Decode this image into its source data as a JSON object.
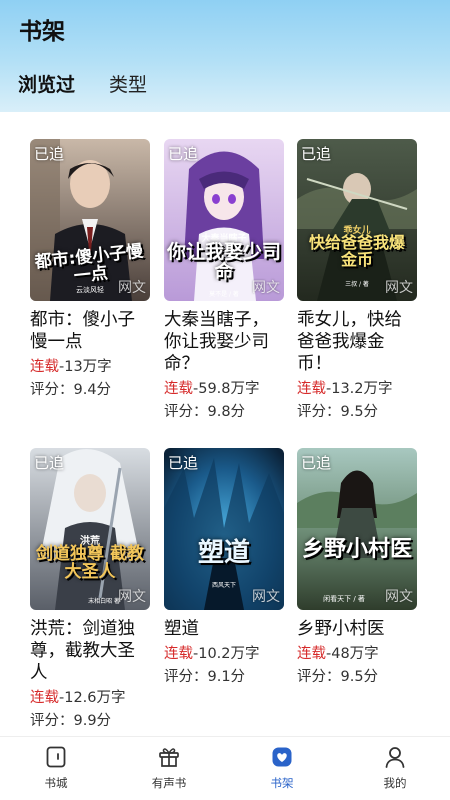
{
  "header": {
    "title": "书架",
    "tabs": [
      {
        "label": "浏览过",
        "active": true
      },
      {
        "label": "类型",
        "active": false
      }
    ]
  },
  "books": [
    {
      "badge": "已追",
      "cover_text": "都市:傻小子慢一点",
      "cover_author": "云淡风轻",
      "watermark": "网文",
      "title_lines": [
        "都市：傻小子",
        "慢一点"
      ],
      "status": "连载",
      "words": "-13万字",
      "rating": "评分：9.4分"
    },
    {
      "badge": "已追",
      "cover_top": "大秦当瞎子",
      "cover_text": "你让我娶少司命",
      "cover_author": "莫不是 / 著",
      "watermark": "网文",
      "title_lines": [
        "大秦当瞎子，",
        "你让我娶少司",
        "命？"
      ],
      "status": "连载",
      "words": "-59.8万字",
      "rating": "评分：9.8分"
    },
    {
      "badge": "已追",
      "cover_top": "乖女儿",
      "cover_text": "快给爸爸我爆金币",
      "cover_author": "三叔 / 著",
      "watermark": "网文",
      "title_lines": [
        "乖女儿，快给",
        "爸爸我爆金",
        "币！"
      ],
      "status": "连载",
      "words": "-13.2万字",
      "rating": "评分：9.5分"
    },
    {
      "badge": "已追",
      "cover_top": "洪荒",
      "cover_text": "剑道独尊 截教大圣人",
      "cover_author": "末相白昭 著",
      "watermark": "网文",
      "title_lines": [
        "洪荒：剑道独",
        "尊，截教大圣",
        "人"
      ],
      "status": "连载",
      "words": "-12.6万字",
      "rating": "评分：9.9分"
    },
    {
      "badge": "已追",
      "cover_text": "塑道",
      "cover_author": "西风天下",
      "watermark": "网文",
      "title_lines": [
        "塑道"
      ],
      "status": "连载",
      "words": "-10.2万字",
      "rating": "评分：9.1分"
    },
    {
      "badge": "已追",
      "cover_text": "乡野小村医",
      "cover_author": "闲看天下 / 著",
      "watermark": "网文",
      "title_lines": [
        "乡野小村医"
      ],
      "status": "连载",
      "words": "-48万字",
      "rating": "评分：9.5分"
    }
  ],
  "nav": [
    {
      "label": "书城",
      "icon": "bookstore-icon",
      "active": false
    },
    {
      "label": "有声书",
      "icon": "audiobook-icon",
      "active": false
    },
    {
      "label": "书架",
      "icon": "bookshelf-icon",
      "active": true
    },
    {
      "label": "我的",
      "icon": "profile-icon",
      "active": false
    }
  ],
  "colors": {
    "accent": "#2a63c9",
    "status_red": "#d62b2b",
    "header_top": "#8fd0f3"
  }
}
